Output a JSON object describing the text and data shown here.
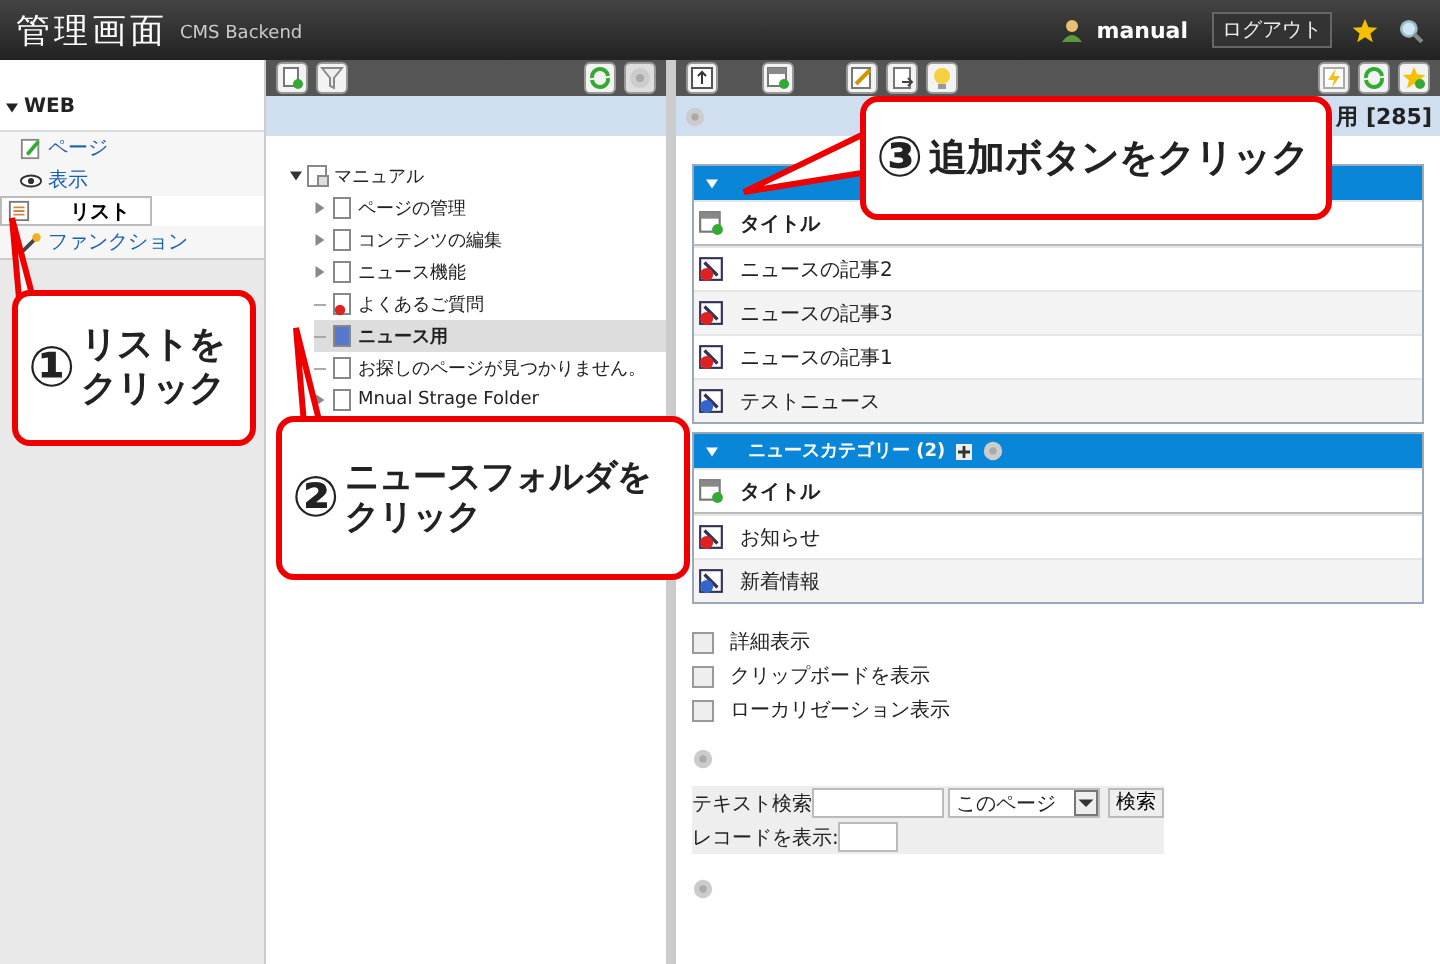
{
  "header": {
    "title": "管理画面",
    "subtitle": "CMS Backend",
    "user": "manual",
    "logout": "ログアウト"
  },
  "sidebar": {
    "section": "WEB",
    "items": [
      {
        "label": "ページ",
        "selected": false
      },
      {
        "label": "表示",
        "selected": false
      },
      {
        "label": "リスト",
        "selected": true
      },
      {
        "label": "ファンクション",
        "selected": false
      }
    ]
  },
  "tree": {
    "label": "マニュアル",
    "expanded": true,
    "children": [
      {
        "label": "ページの管理",
        "expanded": false,
        "selected": false,
        "alert": false
      },
      {
        "label": "コンテンツの編集",
        "expanded": false,
        "selected": false,
        "alert": false
      },
      {
        "label": "ニュース機能",
        "expanded": false,
        "selected": false,
        "alert": false
      },
      {
        "label": "よくあるご質問",
        "selected": false,
        "alert": true
      },
      {
        "label": "ニュース用",
        "selected": true,
        "alert": false
      },
      {
        "label": "お探しのページが見つかりません。",
        "selected": false,
        "alert": false
      },
      {
        "label": "Mnual Strage Folder",
        "expanded": false,
        "selected": false,
        "alert": false
      }
    ]
  },
  "list_panel": {
    "title": "用 [285]",
    "tables": [
      {
        "rows": [
          {
            "kind": "header",
            "label": "タイトル"
          },
          {
            "kind": "item",
            "label": "ニュースの記事2",
            "alert": true
          },
          {
            "kind": "item",
            "label": "ニュースの記事3",
            "alert": true
          },
          {
            "kind": "item",
            "label": "ニュースの記事1",
            "alert": true
          },
          {
            "kind": "item",
            "label": "テストニュース",
            "alert": false
          }
        ]
      },
      {
        "heading": "ニュースカテゴリー (2)",
        "rows": [
          {
            "kind": "header",
            "label": "タイトル"
          },
          {
            "kind": "item",
            "label": "お知らせ",
            "alert": true
          },
          {
            "kind": "item",
            "label": "新着情報",
            "alert": false
          }
        ]
      }
    ],
    "options": [
      {
        "label": "詳細表示",
        "checked": false
      },
      {
        "label": "クリップボードを表示",
        "checked": false
      },
      {
        "label": "ローカリゼーション表示",
        "checked": false
      }
    ],
    "search": {
      "label": "テキスト検索",
      "scope": "このページ",
      "button": "検索",
      "records_label": "レコードを表示:"
    }
  },
  "callouts": [
    {
      "number": "①",
      "lines": [
        "リストを",
        "クリック"
      ]
    },
    {
      "number": "②",
      "lines": [
        "ニュースフォルダを",
        "クリック"
      ]
    },
    {
      "number": "③",
      "lines": [
        "追加ボタンをクリック"
      ]
    }
  ]
}
